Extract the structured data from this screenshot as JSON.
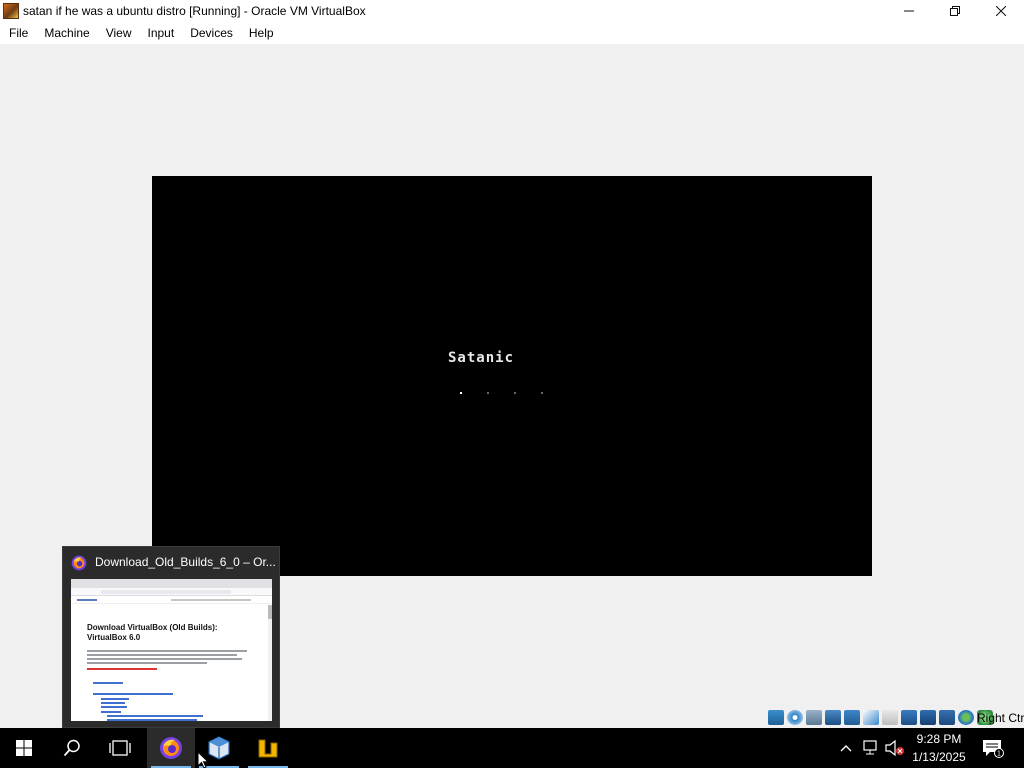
{
  "window": {
    "title": "satan if he was a ubuntu distro [Running] - Oracle VM VirtualBox",
    "minimize_icon": "minimize-icon",
    "restore_icon": "restore-icon",
    "close_icon": "close-icon"
  },
  "menu": {
    "items": [
      {
        "label": "File"
      },
      {
        "label": "Machine"
      },
      {
        "label": "View"
      },
      {
        "label": "Input"
      },
      {
        "label": "Devices"
      },
      {
        "label": "Help"
      }
    ]
  },
  "vm": {
    "boot_text": "Satanic",
    "dots": 4
  },
  "statusbar": {
    "icons": [
      "hard-disk-icon",
      "optical-drive-icon",
      "audio-icon",
      "network-icon",
      "usb-icon",
      "shared-folders-icon",
      "display-icon",
      "recording-icon",
      "video-capture-icon",
      "cpu-icon",
      "mouse-integration-icon",
      "keyboard-icon"
    ],
    "host_key": "Right Ctrl"
  },
  "preview": {
    "title": "Download_Old_Builds_6_0 – Or...",
    "page_heading_line1": "Download VirtualBox (Old Builds):",
    "page_heading_line2": "VirtualBox 6.0"
  },
  "taskbar": {
    "items": [
      "windows-start-icon",
      "search-icon",
      "task-view-icon",
      "firefox-icon",
      "virtualbox-icon",
      "app-icon"
    ]
  },
  "clock": {
    "time": "9:28 PM",
    "date": "1/13/2025"
  },
  "notifications": {
    "count": "1"
  },
  "colors": {
    "taskbar": "#000000",
    "accent_underline": "#76b9ed",
    "vm_screen": "#000000"
  }
}
